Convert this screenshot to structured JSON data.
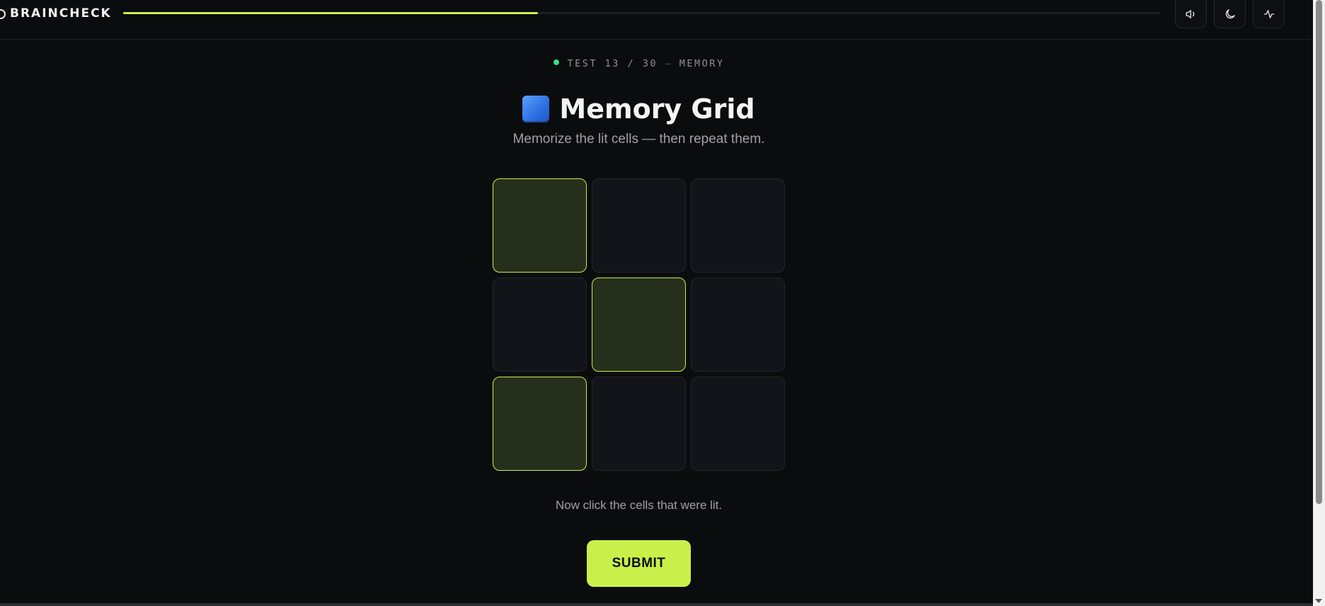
{
  "header": {
    "brand": "BRAINCHECK",
    "progress_fraction": 0.4,
    "buttons": [
      {
        "name": "sound-button",
        "icon": "speaker-icon"
      },
      {
        "name": "theme-button",
        "icon": "moon-icon"
      },
      {
        "name": "stats-button",
        "icon": "activity-icon"
      }
    ]
  },
  "test": {
    "counter": "TEST 13 / 30",
    "separator": "—",
    "category": "MEMORY"
  },
  "title": {
    "icon": "blue-square-icon",
    "text": "Memory Grid"
  },
  "subtitle": "Memorize the lit cells — then repeat them.",
  "grid": {
    "rows": 3,
    "cols": 3,
    "cells": [
      {
        "lit": true
      },
      {
        "lit": false
      },
      {
        "lit": false
      },
      {
        "lit": false
      },
      {
        "lit": true
      },
      {
        "lit": false
      },
      {
        "lit": true
      },
      {
        "lit": false
      },
      {
        "lit": false
      }
    ]
  },
  "instruction": "Now click the cells that were lit.",
  "submit_label": "SUBMIT",
  "colors": {
    "accent": "#c9f04a",
    "background": "#0b0c0e",
    "lit_cell": "#262f1b",
    "status_dot": "#3ddc84"
  }
}
